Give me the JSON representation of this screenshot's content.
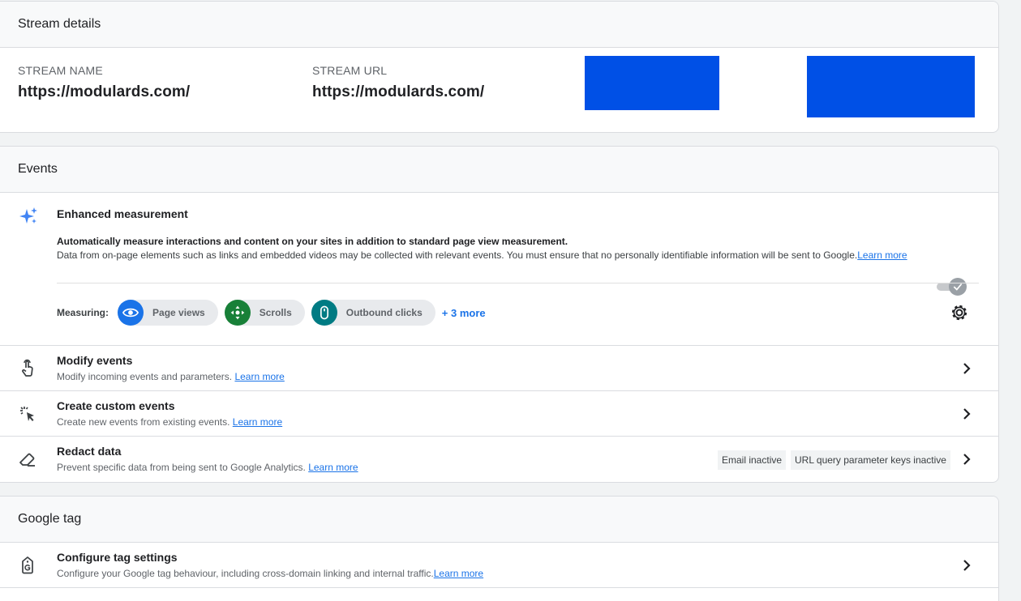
{
  "stream_details": {
    "header": "Stream details",
    "name_label": "STREAM NAME",
    "name_value": "https://modulards.com/",
    "url_label": "STREAM URL",
    "url_value": "https://modulards.com/"
  },
  "events": {
    "header": "Events",
    "enhanced": {
      "title": "Enhanced measurement",
      "desc_bold": "Automatically measure interactions and content on your sites in addition to standard page view measurement.",
      "desc": "Data from on-page elements such as links and embedded videos may be collected with relevant events. You must ensure that no personally identifiable information will be sent to Google.",
      "learn_more": "Learn more",
      "toggle_on": true,
      "measuring_label": "Measuring:",
      "chips": [
        {
          "label": "Page views",
          "icon": "eye-icon",
          "color": "#1a73e8"
        },
        {
          "label": "Scrolls",
          "icon": "move-arrows-icon",
          "color": "#188038"
        },
        {
          "label": "Outbound clicks",
          "icon": "mouse-icon",
          "color": "#007b83"
        }
      ],
      "more": "+ 3 more"
    },
    "rows": [
      {
        "title": "Modify events",
        "sub": "Modify incoming events and parameters.",
        "learn_more": "Learn more",
        "icon": "touch-hand-icon"
      },
      {
        "title": "Create custom events",
        "sub": "Create new events from existing events.",
        "learn_more": "Learn more",
        "icon": "cursor-sparkle-icon"
      },
      {
        "title": "Redact data",
        "sub": "Prevent specific data from being sent to Google Analytics.",
        "learn_more": "Learn more",
        "icon": "eraser-icon",
        "badges": [
          "Email inactive",
          "URL query parameter keys inactive"
        ]
      }
    ]
  },
  "google_tag": {
    "header": "Google tag",
    "rows": [
      {
        "title": "Configure tag settings",
        "sub": "Configure your Google tag behaviour, including cross-domain linking and internal traffic.",
        "learn_more": "Learn more",
        "icon": "tag-icon"
      }
    ]
  },
  "colors": {
    "accent": "#1a73e8",
    "redaction": "#0050e6"
  }
}
